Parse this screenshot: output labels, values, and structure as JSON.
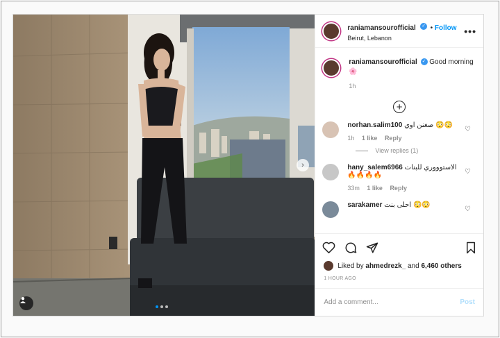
{
  "post": {
    "username": "raniamansourofficial",
    "follow_label": "Follow",
    "location": "Beirut, Lebanon",
    "more_label": "•••",
    "caption": "Good morning",
    "caption_emoji": "🌸",
    "caption_time": "1h"
  },
  "comments": [
    {
      "username": "norhan.salim100",
      "text": "صغنن اوي 😳😳",
      "time": "1h",
      "likes": "1 like",
      "reply": "Reply",
      "view_replies": "View replies (1)"
    },
    {
      "username": "hany_salem6966",
      "text": "الاستوووري للبنات",
      "emoji": "🔥🔥🔥🔥",
      "time": "33m",
      "likes": "1 like",
      "reply": "Reply"
    },
    {
      "username": "sarakamer",
      "text": "احلى بنت 😳😳"
    }
  ],
  "likes": {
    "liked_by_prefix": "Liked by",
    "liked_by_user": "ahmedrezk_",
    "and_label": "and",
    "others": "6,460 others"
  },
  "time_ago": "1 HOUR AGO",
  "add_comment": {
    "placeholder": "Add a comment...",
    "post_label": "Post"
  },
  "colors": {
    "accent": "#0095f6",
    "post_disabled": "#b2dffc",
    "muted": "#8e8e8e"
  }
}
